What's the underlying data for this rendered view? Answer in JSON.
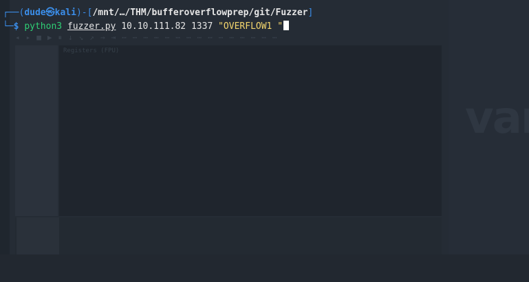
{
  "terminal": {
    "prompt": {
      "user": "dude",
      "separator_icon": "skull-icon",
      "host": "kali",
      "path": "/mnt/…/THM/bufferoverflowprep/git/Fuzzer",
      "symbol": "$"
    },
    "command": {
      "program": "python3",
      "file": "fuzzer.py",
      "ip": "10.10.111.82",
      "port": "1337",
      "payload": "\"OVERFLOW1 \""
    }
  },
  "background": {
    "logo_fragment": "var",
    "register_panel_title": "Registers (FPU)"
  },
  "colors": {
    "accent_blue": "#3b8eea",
    "command_green": "#2fcf75",
    "string_yellow": "#f5d76e",
    "text": "#e6e6e6"
  }
}
